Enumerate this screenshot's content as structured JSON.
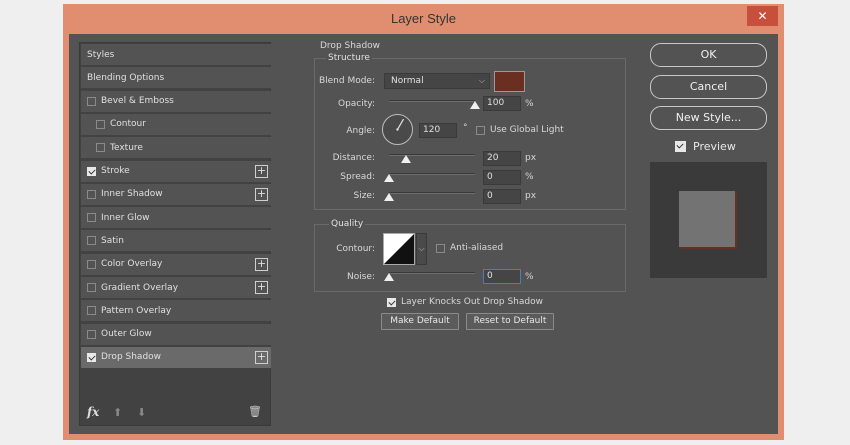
{
  "window": {
    "title": "Layer Style",
    "close_glyph": "✕"
  },
  "sidebar": {
    "items": [
      {
        "label": "Styles",
        "has_checkbox": false,
        "checked": false,
        "has_plus": false,
        "indent": false,
        "active": false
      },
      {
        "label": "Blending Options",
        "has_checkbox": false,
        "checked": false,
        "has_plus": false,
        "indent": false,
        "active": false
      },
      {
        "label": "Bevel & Emboss",
        "has_checkbox": true,
        "checked": false,
        "has_plus": false,
        "indent": false,
        "active": false
      },
      {
        "label": "Contour",
        "has_checkbox": true,
        "checked": false,
        "has_plus": false,
        "indent": true,
        "active": false
      },
      {
        "label": "Texture",
        "has_checkbox": true,
        "checked": false,
        "has_plus": false,
        "indent": true,
        "active": false
      },
      {
        "label": "Stroke",
        "has_checkbox": true,
        "checked": true,
        "has_plus": true,
        "indent": false,
        "active": false
      },
      {
        "label": "Inner Shadow",
        "has_checkbox": true,
        "checked": false,
        "has_plus": true,
        "indent": false,
        "active": false
      },
      {
        "label": "Inner Glow",
        "has_checkbox": true,
        "checked": false,
        "has_plus": false,
        "indent": false,
        "active": false
      },
      {
        "label": "Satin",
        "has_checkbox": true,
        "checked": false,
        "has_plus": false,
        "indent": false,
        "active": false
      },
      {
        "label": "Color Overlay",
        "has_checkbox": true,
        "checked": false,
        "has_plus": true,
        "indent": false,
        "active": false
      },
      {
        "label": "Gradient Overlay",
        "has_checkbox": true,
        "checked": false,
        "has_plus": true,
        "indent": false,
        "active": false
      },
      {
        "label": "Pattern Overlay",
        "has_checkbox": true,
        "checked": false,
        "has_plus": false,
        "indent": false,
        "active": false
      },
      {
        "label": "Outer Glow",
        "has_checkbox": true,
        "checked": false,
        "has_plus": false,
        "indent": false,
        "active": false
      },
      {
        "label": "Drop Shadow",
        "has_checkbox": true,
        "checked": true,
        "has_plus": true,
        "indent": false,
        "active": true
      }
    ],
    "footer": {
      "fx_label": "fx",
      "up_glyph": "⬆",
      "down_glyph": "⬇",
      "trash_glyph": "🗑"
    },
    "plus_glyph": "+"
  },
  "drop_shadow": {
    "section_title": "Drop Shadow",
    "structure": {
      "title": "Structure",
      "blend_mode_label": "Blend Mode:",
      "blend_mode_value": "Normal",
      "shadow_color": "#6b2f21",
      "opacity_label": "Opacity:",
      "opacity_value": "100",
      "opacity_unit": "%",
      "opacity_level": 1.0,
      "angle_label": "Angle:",
      "angle_value": "120",
      "angle_unit": "°",
      "angle_degrees": 120,
      "use_global_light_label": "Use Global Light",
      "use_global_light_checked": false,
      "distance_label": "Distance:",
      "distance_value": "20",
      "distance_unit": "px",
      "distance_level": 0.2,
      "spread_label": "Spread:",
      "spread_value": "0",
      "spread_unit": "%",
      "spread_level": 0,
      "size_label": "Size:",
      "size_value": "0",
      "size_unit": "px",
      "size_level": 0
    },
    "quality": {
      "title": "Quality",
      "contour_label": "Contour:",
      "anti_aliased_label": "Anti-aliased",
      "anti_aliased_checked": false,
      "noise_label": "Noise:",
      "noise_value": "0",
      "noise_unit": "%",
      "noise_level": 0
    },
    "knockout_label": "Layer Knocks Out Drop Shadow",
    "knockout_checked": true,
    "make_default_label": "Make Default",
    "reset_default_label": "Reset to Default"
  },
  "right": {
    "ok_label": "OK",
    "cancel_label": "Cancel",
    "new_style_label": "New Style...",
    "preview_label": "Preview",
    "preview_checked": true
  }
}
